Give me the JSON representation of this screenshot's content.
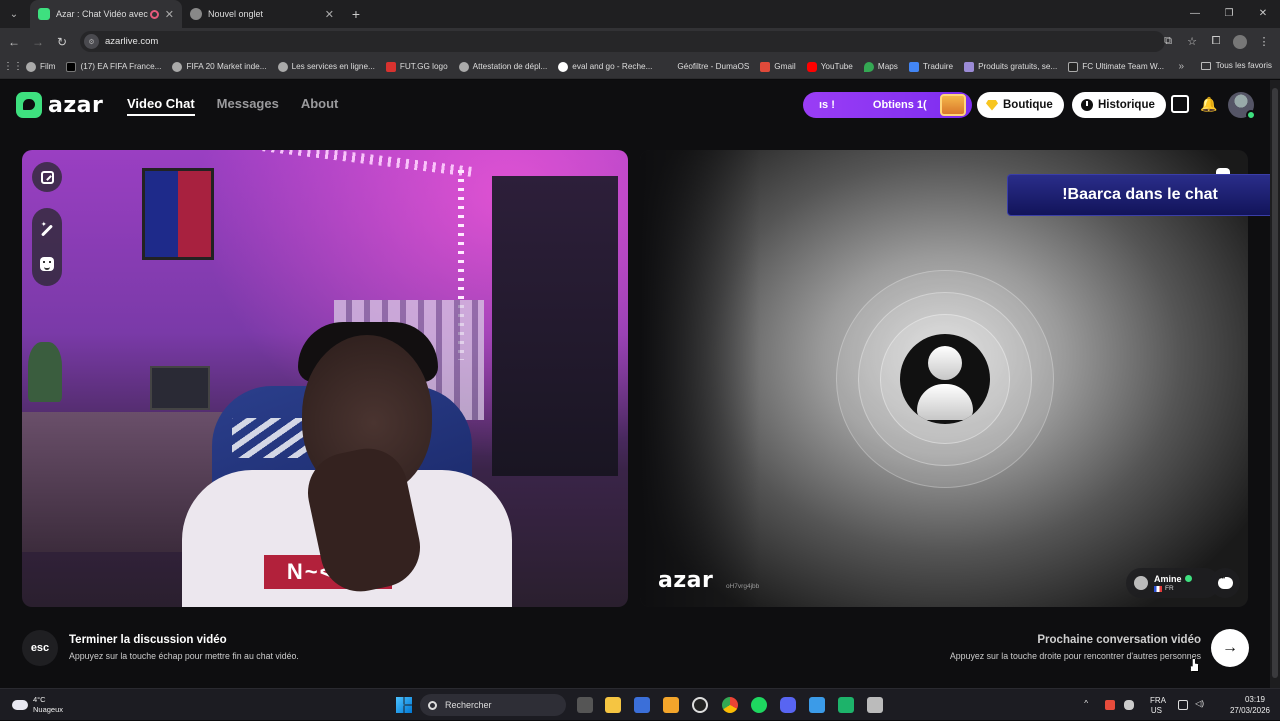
{
  "browser": {
    "tabs": [
      {
        "title": "Azar : Chat Vidéo avec de no",
        "active": true
      },
      {
        "title": "Nouvel onglet",
        "active": false
      }
    ],
    "url": "azarlive.com",
    "bookmarks": [
      "Film",
      "(17) EA FIFA France...",
      "FIFA 20 Market inde...",
      "Les services en ligne...",
      "FUT.GG logo",
      "Attestation de dépl...",
      "eval and go - Reche...",
      "Géofiltre - DumaOS",
      "Gmail",
      "YouTube",
      "Maps",
      "Traduire",
      "Produits gratuits, se...",
      "FC Ultimate Team W..."
    ],
    "all_bookmarks": "Tous les favoris"
  },
  "header": {
    "logo_text": "azar",
    "nav": [
      {
        "label": "Video Chat",
        "active": true
      },
      {
        "label": "Messages",
        "active": false
      },
      {
        "label": "About",
        "active": false
      }
    ],
    "promo_left": "ıs !",
    "promo_right": "Obtiens 1(",
    "boutique": "Boutique",
    "historique": "Historique"
  },
  "remote": {
    "overlay": "!Baarca dans le chat",
    "logo_text": "azar",
    "session_id": "oH7vrg4jbb",
    "user_name": "Amine",
    "user_country": "FR"
  },
  "bottom": {
    "esc_key": "esc",
    "end_title": "Terminer la discussion vidéo",
    "end_sub": "Appuyez sur la touche échap pour mettre fin au chat vidéo.",
    "next_title": "Prochaine conversation vidéo",
    "next_sub": "Appuyez sur la touche droite pour rencontrer d'autres personnes"
  },
  "taskbar": {
    "weather_temp": "4°C",
    "weather_desc": "Nuageux",
    "search": "Rechercher",
    "lang_top": "FRA",
    "lang_bottom": "US",
    "time": "03:19",
    "date": "27/03/2026"
  },
  "colors": {
    "brand_green": "#3ee07f",
    "promo_purple": "#8a35f2",
    "banner_blue": "#1e2078"
  }
}
